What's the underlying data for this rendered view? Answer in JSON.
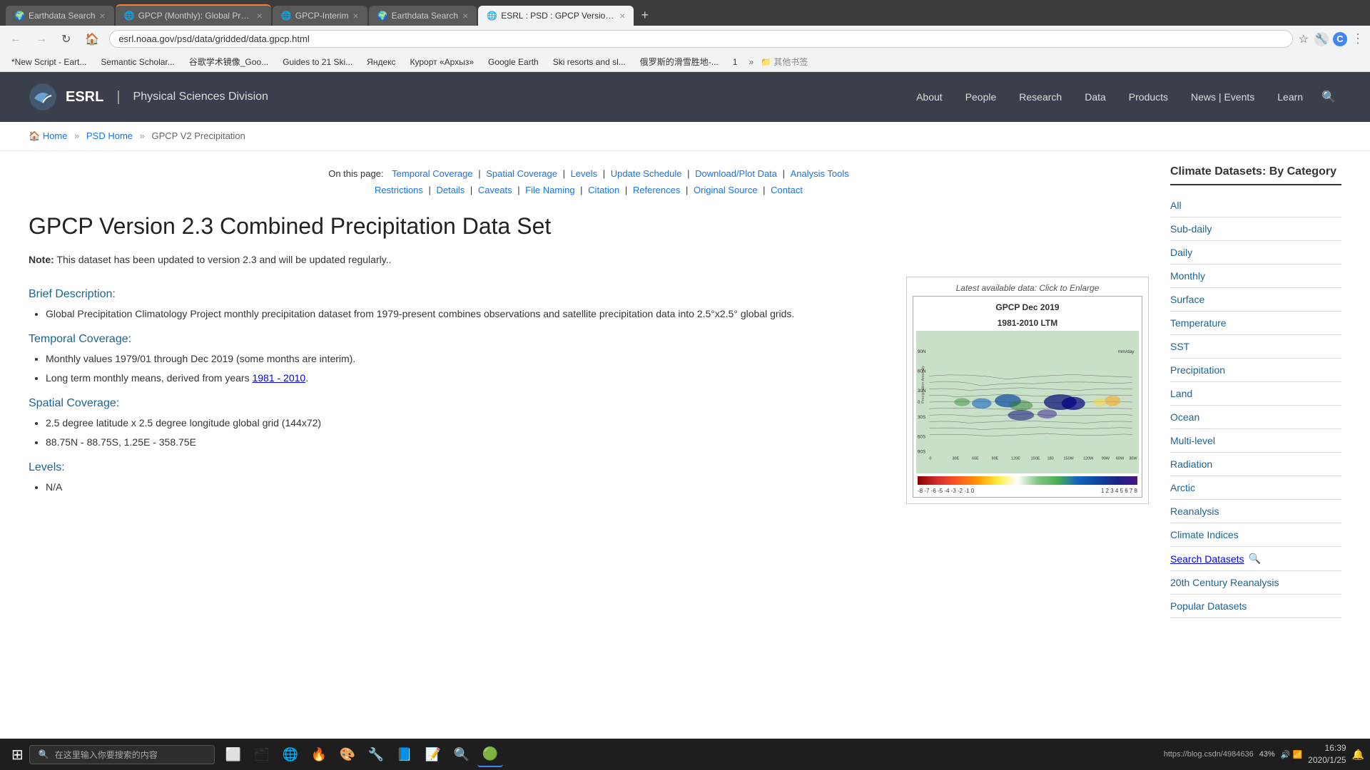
{
  "browser": {
    "tabs": [
      {
        "id": "tab1",
        "title": "Earthdata Search",
        "active": false,
        "favicon": "🌍"
      },
      {
        "id": "tab2",
        "title": "GPCP (Monthly): Global Precip...",
        "active": false,
        "favicon": "🌐",
        "loading": true
      },
      {
        "id": "tab3",
        "title": "GPCP-Interim",
        "active": false,
        "favicon": "🌐"
      },
      {
        "id": "tab4",
        "title": "Earthdata Search",
        "active": false,
        "favicon": "🌍"
      },
      {
        "id": "tab5",
        "title": "ESRL : PSD : GPCP Version 2.3",
        "active": true,
        "favicon": "🌐"
      }
    ],
    "url": "esrl.noaa.gov/psd/data/gridded/data.gpcp.html",
    "bookmarks": [
      "*New Script - Eart...",
      "Semantic Scholar...",
      "谷歌学术镜像_Goo...",
      "Guides to 21 Ski...",
      "Яндекс",
      "Курорт «Архыз»",
      "Google Earth",
      "Ski resorts and sl...",
      "俄罗斯的滑雪胜地-...",
      "1"
    ]
  },
  "header": {
    "logo_text": "ESRL",
    "divider": "|",
    "subtitle": "Physical Sciences Division",
    "nav_items": [
      "About",
      "People",
      "Research",
      "Data",
      "Products",
      "News | Events",
      "Learn"
    ]
  },
  "breadcrumb": {
    "home": "Home",
    "psd_home": "PSD Home",
    "current": "GPCP V2 Precipitation"
  },
  "page_links": {
    "items": [
      "Temporal Coverage",
      "Spatial Coverage",
      "Levels",
      "Update Schedule",
      "Download/Plot Data",
      "Analysis Tools",
      "Restrictions",
      "Details",
      "Caveats",
      "File Naming",
      "Citation",
      "References",
      "Original Source",
      "Contact"
    ],
    "prefix": "On this page:"
  },
  "page_title": "GPCP Version 2.3 Combined Precipitation Data Set",
  "note": {
    "label": "Note:",
    "text": "This dataset has been updated to version 2.3 and will be updated regularly.."
  },
  "sections": {
    "brief_description": {
      "heading": "Brief Description:",
      "bullets": [
        "Global Precipitation Climatology Project monthly precipitation dataset from 1979-present combines observations and satellite precipitation data into 2.5°x2.5° global grids."
      ]
    },
    "temporal_coverage": {
      "heading": "Temporal Coverage:",
      "bullets": [
        "Monthly values 1979/01 through Dec 2019 (some months are interim).",
        "Long term monthly means, derived from years 1981 - 2010."
      ]
    },
    "spatial_coverage": {
      "heading": "Spatial Coverage:",
      "bullets": [
        "2.5 degree latitude x 2.5 degree longitude global grid (144x72)",
        "88.75N - 88.75S, 1.25E - 358.75E"
      ]
    },
    "levels": {
      "heading": "Levels:",
      "bullets": [
        "N/A"
      ]
    }
  },
  "map": {
    "caption": "Latest available data: Click to Enlarge",
    "title_line1": "GPCP Dec 2019",
    "title_line2": "1981-2010 LTM",
    "y_label": "Precipitation Anomaly",
    "unit": "mm/day"
  },
  "sidebar": {
    "title": "Climate Datasets: By Category",
    "items": [
      {
        "label": "All",
        "link": true
      },
      {
        "label": "Sub-daily",
        "link": true
      },
      {
        "label": "Daily",
        "link": true
      },
      {
        "label": "Monthly",
        "link": true
      },
      {
        "label": "Surface",
        "link": true
      },
      {
        "label": "Temperature",
        "link": true
      },
      {
        "label": "SST",
        "link": true
      },
      {
        "label": "Precipitation",
        "link": true
      },
      {
        "label": "Land",
        "link": true
      },
      {
        "label": "Ocean",
        "link": true
      },
      {
        "label": "Multi-level",
        "link": true
      },
      {
        "label": "Radiation",
        "link": true
      },
      {
        "label": "Arctic",
        "link": true
      },
      {
        "label": "Reanalysis",
        "link": true
      },
      {
        "label": "Climate Indices",
        "link": true
      },
      {
        "label": "Search Datasets",
        "link": true,
        "has_icon": true
      },
      {
        "label": "20th Century Reanalysis",
        "link": true
      },
      {
        "label": "Popular Datasets",
        "link": true
      }
    ]
  },
  "taskbar": {
    "search_placeholder": "在这里输入你要搜索的内容",
    "time": "16:39",
    "date": "2020/1/25",
    "battery": "43%",
    "taskbar_icons": [
      "⊞",
      "🔍",
      "⬜",
      "🗂",
      "🌐",
      "🔥",
      "🎨",
      "🔧",
      "📘",
      "📝",
      "🔍",
      "🟢"
    ],
    "status_text": "https://blog.csdn/4984636"
  }
}
